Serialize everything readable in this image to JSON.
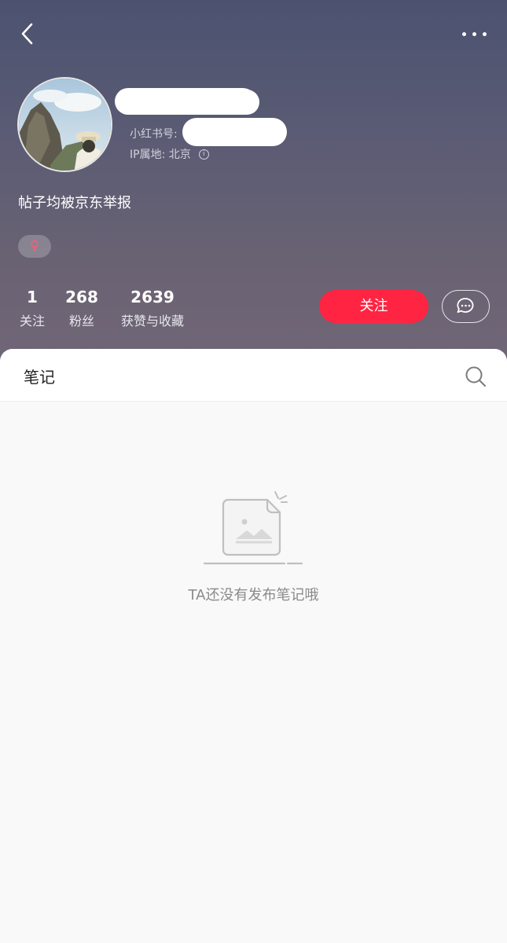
{
  "header": {
    "back_icon": "chevron-left-icon",
    "more_icon": "more-horizontal-icon"
  },
  "profile": {
    "redbook_id_label": "小红书号:",
    "ip_location": "IP属地: 北京",
    "bio": "帖子均被京东举报",
    "gender_symbol": "♀",
    "gender_color": "#ff5a74"
  },
  "stats": [
    {
      "value": "1",
      "label": "关注"
    },
    {
      "value": "268",
      "label": "粉丝"
    },
    {
      "value": "2639",
      "label": "获赞与收藏"
    }
  ],
  "actions": {
    "follow_label": "关注",
    "follow_color": "#ff2442",
    "message_icon": "chat-bubble-icon"
  },
  "tabs": {
    "notes_label": "笔记",
    "search_icon": "search-icon"
  },
  "empty_state": {
    "icon": "empty-document-icon",
    "text": "TA还没有发布笔记哦"
  }
}
